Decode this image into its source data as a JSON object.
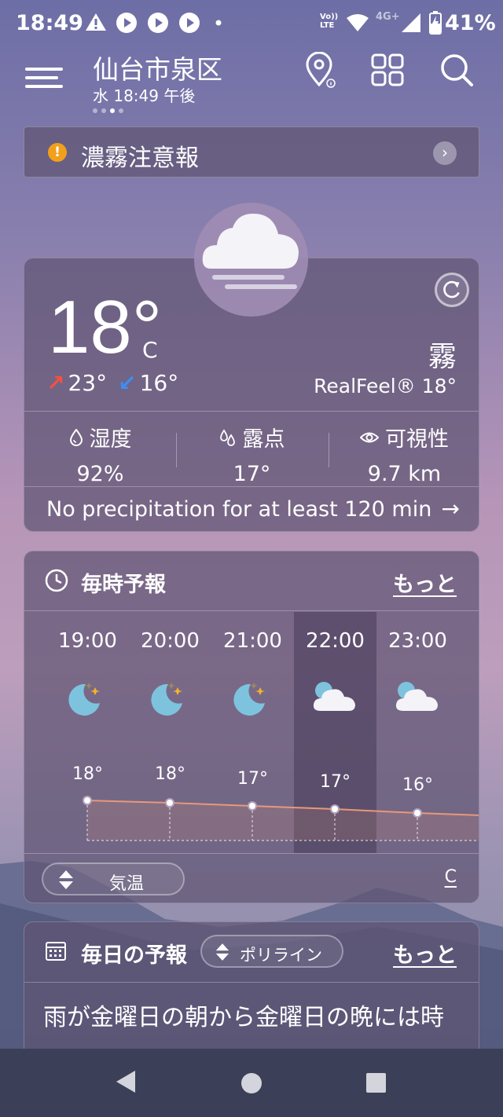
{
  "status_bar": {
    "time": "18:49",
    "network_badge_top": "Vo))",
    "network_badge_bottom": "LTE",
    "network_type": "4G+",
    "battery": "41%"
  },
  "header": {
    "location": "仙台市泉区",
    "datetime": "水 18:49 午後",
    "icons": [
      "menu-icon",
      "location-pin-icon",
      "grid-icon",
      "search-icon"
    ]
  },
  "alert": {
    "icon_symbol": "!",
    "text": "濃霧注意報",
    "chevron": "›"
  },
  "current": {
    "temperature": "18°",
    "unit": "C",
    "high": "23°",
    "low": "16°",
    "condition": "霧",
    "realfeel": "RealFeel® 18°",
    "metrics": [
      {
        "label": "湿度",
        "value": "92%",
        "icon": "humidity-icon"
      },
      {
        "label": "露点",
        "value": "17°",
        "icon": "dewpoint-icon"
      },
      {
        "label": "可視性",
        "value": "9.7 km",
        "icon": "eye-icon"
      }
    ],
    "precipitation": "No precipitation for at least 120 min",
    "precip_arrow": "→"
  },
  "hourly": {
    "title": "毎時予報",
    "more": "もっと",
    "hours": [
      {
        "time": "19:00",
        "temp": "18°",
        "icon": "moon-stars-icon"
      },
      {
        "time": "20:00",
        "temp": "18°",
        "icon": "moon-stars-icon"
      },
      {
        "time": "21:00",
        "temp": "17°",
        "icon": "moon-stars-icon"
      },
      {
        "time": "22:00",
        "temp": "17°",
        "icon": "moon-cloud-icon"
      },
      {
        "time": "23:00",
        "temp": "16°",
        "icon": "moon-cloud-icon"
      }
    ],
    "metric_toggle": "気温",
    "unit": "C"
  },
  "daily": {
    "title": "毎日の予報",
    "pill_label": "ポリライン",
    "more": "もっと",
    "summary": "雨が金曜日の朝から金曜日の晩には時"
  },
  "colors": {
    "alert_icon": "#f2a01c",
    "temp_high_arrow": "#f25241",
    "temp_low_arrow": "#3d8ef5",
    "graph_line": "#e8987a",
    "nav_bar": "#3b4058"
  }
}
